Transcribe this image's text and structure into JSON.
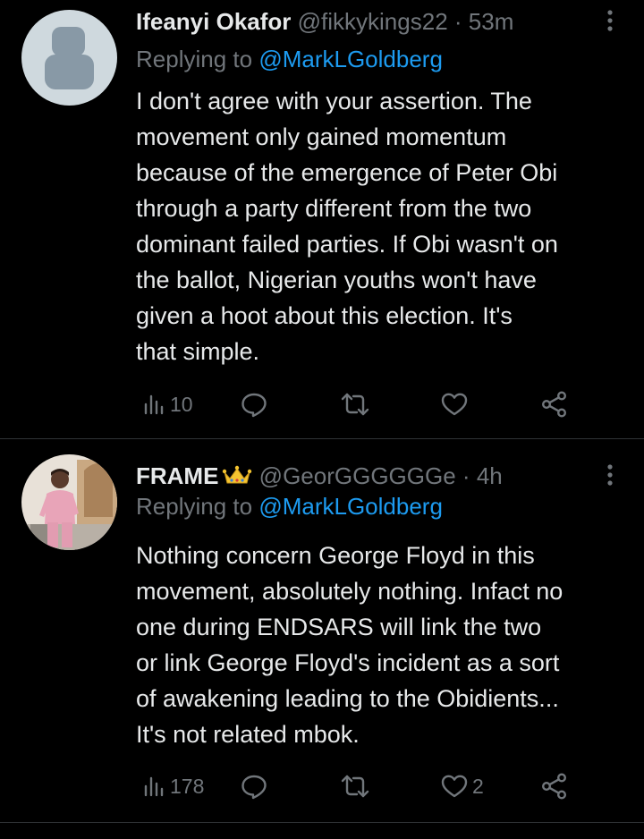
{
  "tweets": [
    {
      "author_name": "Ifeanyi Okafor",
      "handle": "@fikkykings22",
      "separator": "·",
      "time": "53m",
      "replying_prefix": "Replying to",
      "replying_to": "@MarkLGoldberg",
      "text": "I don't agree with your assertion. The\nmovement only gained momentum\nbecause of the emergence of Peter Obi\nthrough a party different from the two\ndominant failed parties. If Obi wasn't on\nthe ballot, Nigerian youths won't have\ngiven a hoot about this election. It's\nthat simple.",
      "views": "10",
      "likes": "",
      "avatar": "default-avatar"
    },
    {
      "author_name": "FRAME",
      "badge": "crown-emoji",
      "handle": "@GeorGGGGGGe",
      "separator": "·",
      "time": "4h",
      "replying_prefix": "Replying to",
      "replying_to": "@MarkLGoldberg",
      "text": "Nothing concern George Floyd in this\nmovement, absolutely nothing. Infact no\none during ENDSARS  will link the two\nor link George Floyd's incident as a sort\nof awakening leading to the Obidients...\nIt's not related mbok.",
      "views": "178",
      "likes": "2",
      "avatar": "photo-avatar"
    }
  ],
  "colors": {
    "background": "#000000",
    "text_primary": "#e7e9ea",
    "text_secondary": "#71767b",
    "link": "#1d9bf0",
    "divider": "#2f3336"
  }
}
